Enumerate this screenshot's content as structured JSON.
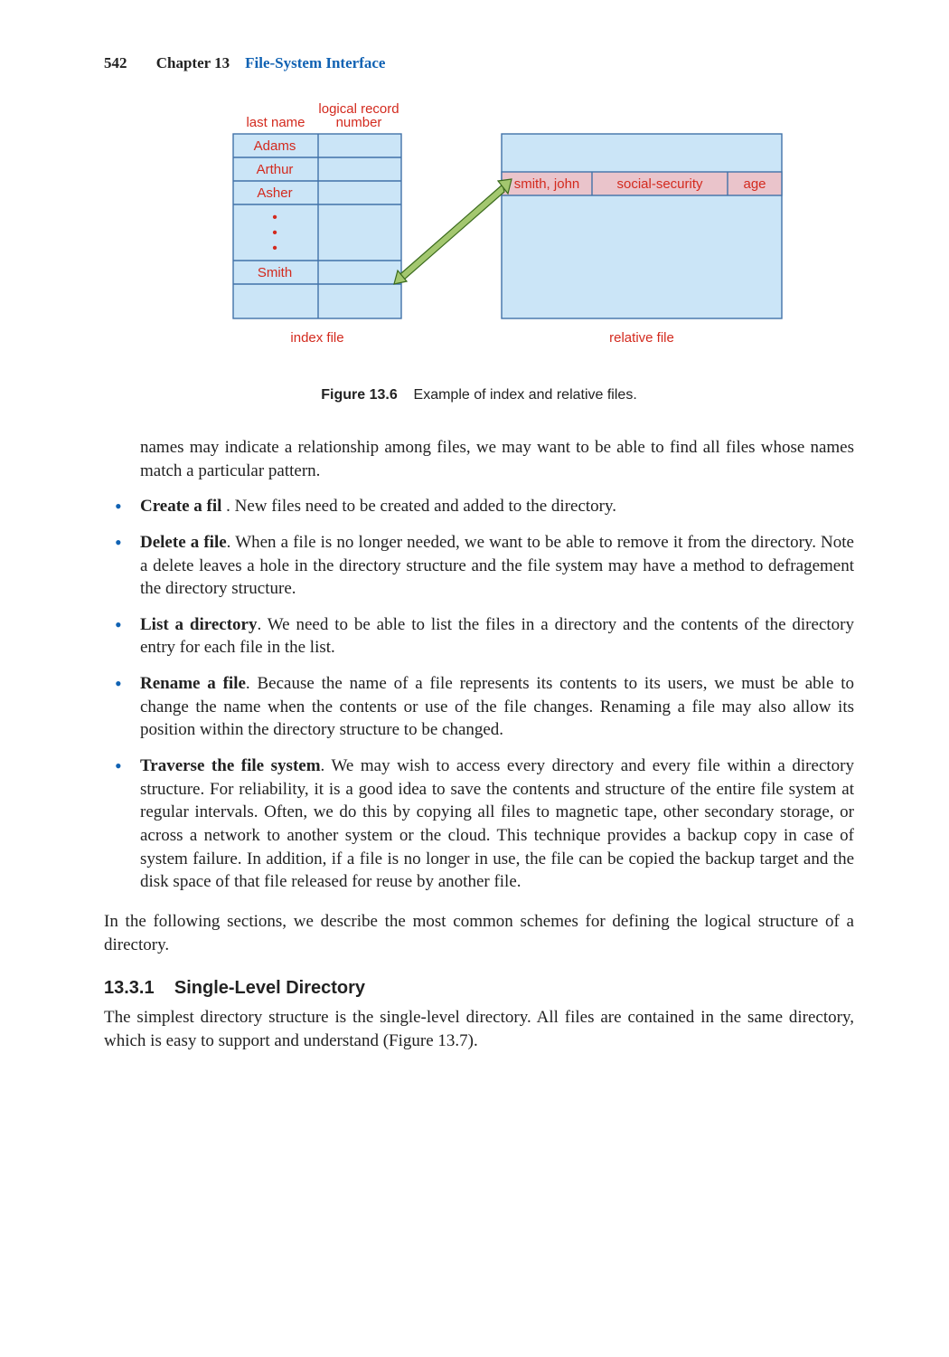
{
  "header": {
    "page_number": "542",
    "chapter_label": "Chapter 13",
    "chapter_title": "File-System Interface"
  },
  "figure": {
    "labels": {
      "last_name": "last name",
      "logical_record_number": "logical record\nnumber",
      "index_file": "index file",
      "relative_file": "relative file"
    },
    "index_rows": [
      "Adams",
      "Arthur",
      "Asher",
      "Smith"
    ],
    "dots": "•",
    "relative_cells": [
      "smith, john",
      "social-security",
      "age"
    ]
  },
  "caption": {
    "figno": "Figure 13.6",
    "text": "Example of index and relative files."
  },
  "paragraphs": {
    "intro": "names may indicate a relationship among files, we may want to be able to find all files whose names match a particular pattern.",
    "after_list": "In the following sections, we describe the most common schemes for defining the logical structure of a directory.",
    "subsection_body": "The simplest directory structure is the single-level directory. All files are contained in the same directory, which is easy to support and understand (Figure 13.7)."
  },
  "list": [
    {
      "title": "Create a fil ",
      "body": ". New files need to be created and added to the directory."
    },
    {
      "title": "Delete a file",
      "body": ". When a file is no longer needed, we want to be able to remove it from the directory. Note a delete leaves a hole in the directory structure and the file system may have a method to defragement the directory structure."
    },
    {
      "title": "List a directory",
      "body": ". We need to be able to list the files in a directory and the contents of the directory entry for each file in the list."
    },
    {
      "title": "Rename a file",
      "body": ". Because the name of a file represents its contents to its users, we must be able to change the name when the contents or use of the file changes. Renaming a file may also allow its position within the directory structure to be changed."
    },
    {
      "title": "Traverse the file system",
      "body": ". We may wish to access every directory and every file within a directory structure. For reliability, it is a good idea to save the contents and structure of the entire file system at regular intervals. Often, we do this by copying all files to magnetic tape, other secondary storage, or across a network to another system or the cloud. This technique provides a backup copy in case of system failure. In addition, if a file is no longer in use, the file can be copied the backup target and the disk space of that file released for reuse by another file."
    }
  ],
  "subsection": {
    "number": "13.3.1",
    "title": "Single-Level Directory"
  }
}
